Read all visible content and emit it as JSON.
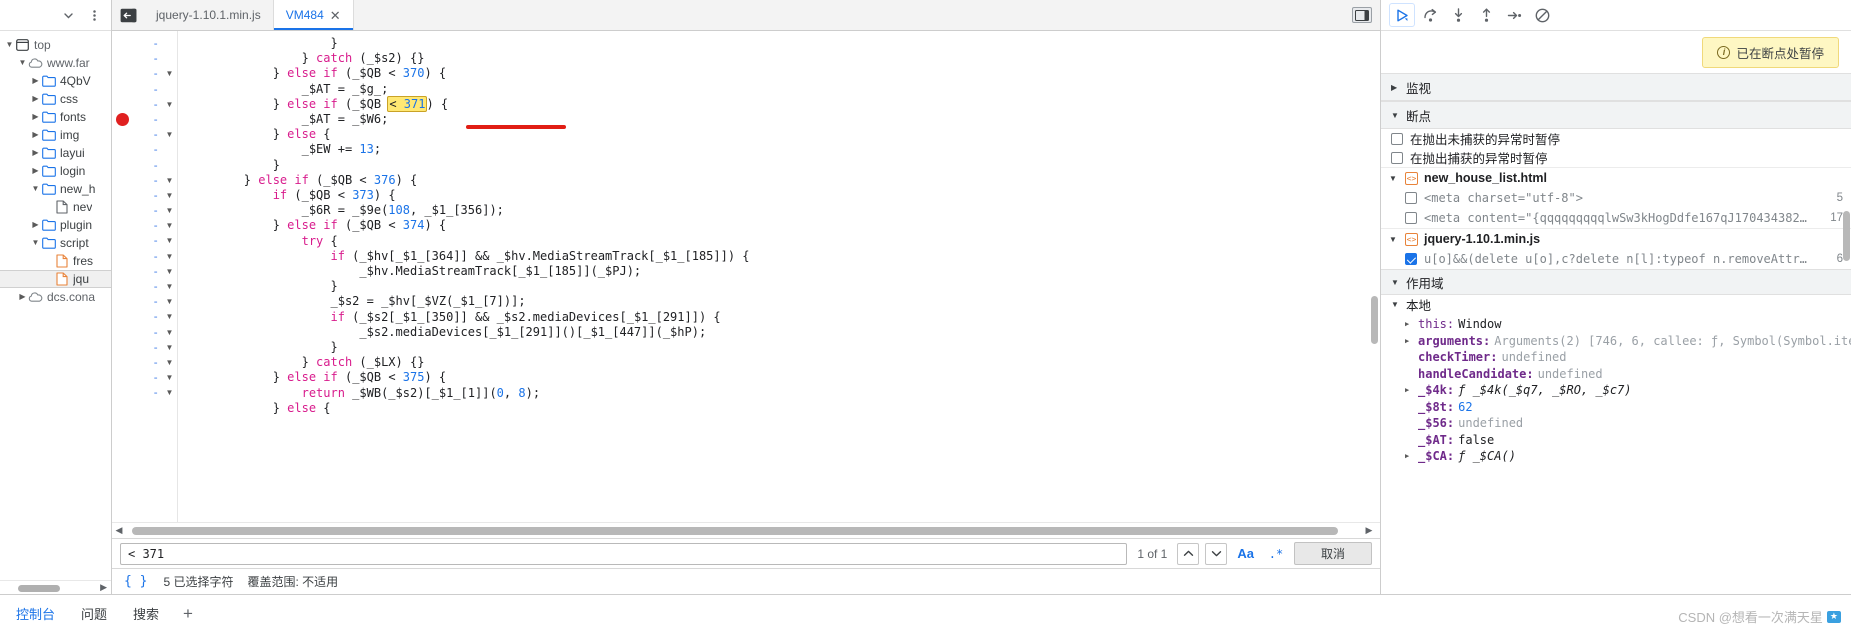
{
  "navigator": {
    "toolbar": {
      "dropdown_icon": "chevron-down-icon",
      "more_icon": "more-vertical-icon"
    },
    "tree": [
      {
        "label": "top",
        "indent": 0,
        "twisty": "down",
        "icon": "frame-icon",
        "kind": "frame"
      },
      {
        "label": "www.far",
        "indent": 1,
        "twisty": "down",
        "icon": "cloud-icon",
        "kind": "domain"
      },
      {
        "label": "4QbV",
        "indent": 2,
        "twisty": "right",
        "icon": "folder-icon",
        "kind": "folder"
      },
      {
        "label": "css",
        "indent": 2,
        "twisty": "right",
        "icon": "folder-icon",
        "kind": "folder"
      },
      {
        "label": "fonts",
        "indent": 2,
        "twisty": "right",
        "icon": "folder-icon",
        "kind": "folder"
      },
      {
        "label": "img",
        "indent": 2,
        "twisty": "right",
        "icon": "folder-icon",
        "kind": "folder"
      },
      {
        "label": "layui",
        "indent": 2,
        "twisty": "right",
        "icon": "folder-icon",
        "kind": "folder"
      },
      {
        "label": "login",
        "indent": 2,
        "twisty": "right",
        "icon": "folder-icon",
        "kind": "folder"
      },
      {
        "label": "new_h",
        "indent": 2,
        "twisty": "down",
        "icon": "folder-icon",
        "kind": "folder"
      },
      {
        "label": "nev",
        "indent": 3,
        "twisty": "none",
        "icon": "file-icon",
        "kind": "file"
      },
      {
        "label": "plugin",
        "indent": 2,
        "twisty": "right",
        "icon": "folder-icon",
        "kind": "folder"
      },
      {
        "label": "script",
        "indent": 2,
        "twisty": "down",
        "icon": "folder-icon",
        "kind": "folder"
      },
      {
        "label": "fres",
        "indent": 3,
        "twisty": "none",
        "icon": "js-file-icon",
        "kind": "jsfile"
      },
      {
        "label": "jqu",
        "indent": 3,
        "twisty": "none",
        "icon": "js-file-icon",
        "kind": "jsfile",
        "selected": true
      },
      {
        "label": "dcs.cona",
        "indent": 1,
        "twisty": "right",
        "icon": "cloud-icon",
        "kind": "domain"
      }
    ]
  },
  "editor": {
    "back_icon": "panel-back-icon",
    "tabs": [
      {
        "label": "jquery-1.10.1.min.js",
        "active": false,
        "closable": false
      },
      {
        "label": "VM484",
        "active": true,
        "closable": true
      }
    ],
    "panel_toggle_icon": "show-panel-icon",
    "gutter": {
      "breakpoint_dot_color": "#e02020",
      "line_marks": [
        "-",
        "-",
        "-",
        "-",
        "-",
        "-",
        "-",
        "-",
        "-",
        "-",
        "-",
        "-",
        "-",
        "-",
        "-",
        "-",
        "-",
        "-",
        "-",
        "-",
        "-",
        "-",
        "-",
        "-"
      ],
      "fold_rows": [
        2,
        4,
        6,
        9,
        10,
        11,
        12,
        13,
        14,
        15,
        16,
        17,
        18,
        19,
        20,
        21,
        22,
        23
      ]
    },
    "code_lines": [
      "                    }",
      "                } catch (_$s2) {}",
      "            } else if (_$QB < 370) {",
      "                _$AT = _$g_;",
      "            } else if (_$QB < 371) {",
      "                _$AT = _$W6;",
      "            } else {",
      "                _$EW += 13;",
      "            }",
      "        } else if (_$QB < 376) {",
      "            if (_$QB < 373) {",
      "                _$6R = _$9e(108, _$1_[356]);",
      "            } else if (_$QB < 374) {",
      "                try {",
      "                    if (_$hv[_$1_[364]] && _$hv.MediaStreamTrack[_$1_[185]]) {",
      "                        _$hv.MediaStreamTrack[_$1_[185]](_$PJ);",
      "                    }",
      "                    _$s2 = _$hv[_$VZ(_$1_[7])];",
      "                    if (_$s2[_$1_[350]] && _$s2.mediaDevices[_$1_[291]]) {",
      "                        _$s2.mediaDevices[_$1_[291]]()[_$1_[447]](_$hP);",
      "                    }",
      "                } catch (_$LX) {}",
      "            } else if (_$QB < 375) {",
      "                return _$WB(_$s2)[_$1_[1]](0, 8);",
      "            } else {"
    ],
    "highlighted_text": "< 371",
    "highlight_line_index": 4,
    "annotation": {
      "type": "red-underline",
      "line_index": 5,
      "color": "#e11d14"
    }
  },
  "search": {
    "value": "< 371",
    "placeholder": "",
    "match_count": "1 of 1",
    "prev_icon": "chevron-up-icon",
    "next_icon": "chevron-down-icon",
    "match_case_label": "Aa",
    "regex_label": ".*",
    "cancel_label": "取消"
  },
  "status": {
    "pretty_print_label": "{ }",
    "selection_text": "5 已选择字符",
    "coverage_text": "覆盖范围: 不适用"
  },
  "debugger": {
    "toolbar": [
      {
        "name": "resume-script-button",
        "icon": "resume-icon",
        "active": true
      },
      {
        "name": "step-over-button",
        "icon": "step-over-icon",
        "active": false
      },
      {
        "name": "step-into-button",
        "icon": "step-into-icon",
        "active": false
      },
      {
        "name": "step-out-button",
        "icon": "step-out-icon",
        "active": false
      },
      {
        "name": "step-button",
        "icon": "step-icon",
        "active": false
      },
      {
        "name": "deactivate-breakpoints-button",
        "icon": "no-breakpoint-icon",
        "active": false
      }
    ],
    "pause_banner": "已在断点处暂停",
    "watch_section": "监视",
    "breakpoints_section": "断点",
    "pause_options": [
      {
        "label": "在抛出未捕获的异常时暂停",
        "checked": false
      },
      {
        "label": "在抛出捕获的异常时暂停",
        "checked": false
      }
    ],
    "breakpoint_groups": [
      {
        "file": "new_house_list.html",
        "items": [
          {
            "snippet": "<meta charset=\"utf-8\">",
            "line": "5",
            "checked": false
          },
          {
            "snippet": "<meta content=\"{qqqqqqqqqlwSw3kHogDdfe167qJ170434382…",
            "line": "17",
            "checked": false
          }
        ]
      },
      {
        "file": "jquery-1.10.1.min.js",
        "items": [
          {
            "snippet": "u[o]&&(delete u[o],c?delete n[l]:typeof n.removeAttr…",
            "line": "6",
            "checked": true
          }
        ]
      }
    ],
    "scope_section": "作用域",
    "scope_local": "本地",
    "scope_vars": [
      {
        "name": "this",
        "value": "Window",
        "expandable": true,
        "indent": 2,
        "bold": false,
        "style": "plain"
      },
      {
        "name": "arguments",
        "value": "Arguments(2) [746, 6, callee: ƒ, Symbol(Symbol.ite",
        "expandable": true,
        "indent": 2,
        "bold": true,
        "style": "grey"
      },
      {
        "name": "checkTimer",
        "value": "undefined",
        "expandable": false,
        "indent": 2,
        "bold": true,
        "style": "undef"
      },
      {
        "name": "handleCandidate",
        "value": "undefined",
        "expandable": false,
        "indent": 2,
        "bold": true,
        "style": "undef"
      },
      {
        "name": "_$4k",
        "value": "ƒ _$4k(_$q7, _$RO, _$c7)",
        "expandable": true,
        "indent": 2,
        "bold": true,
        "style": "fn"
      },
      {
        "name": "_$8t",
        "value": "62",
        "expandable": false,
        "indent": 2,
        "bold": true,
        "style": "num"
      },
      {
        "name": "_$56",
        "value": "undefined",
        "expandable": false,
        "indent": 2,
        "bold": true,
        "style": "undef"
      },
      {
        "name": "_$AT",
        "value": "false",
        "expandable": false,
        "indent": 2,
        "bold": true,
        "style": "plain"
      },
      {
        "name": "_$CA",
        "value": "ƒ _$CA()",
        "expandable": true,
        "indent": 2,
        "bold": true,
        "style": "fn"
      }
    ]
  },
  "drawer": {
    "tabs": [
      {
        "label": "控制台",
        "active": true
      },
      {
        "label": "问题",
        "active": false
      },
      {
        "label": "搜索",
        "active": false
      }
    ],
    "add_tab_icon": "plus-icon",
    "watermark": "CSDN @想看一次满天星"
  }
}
